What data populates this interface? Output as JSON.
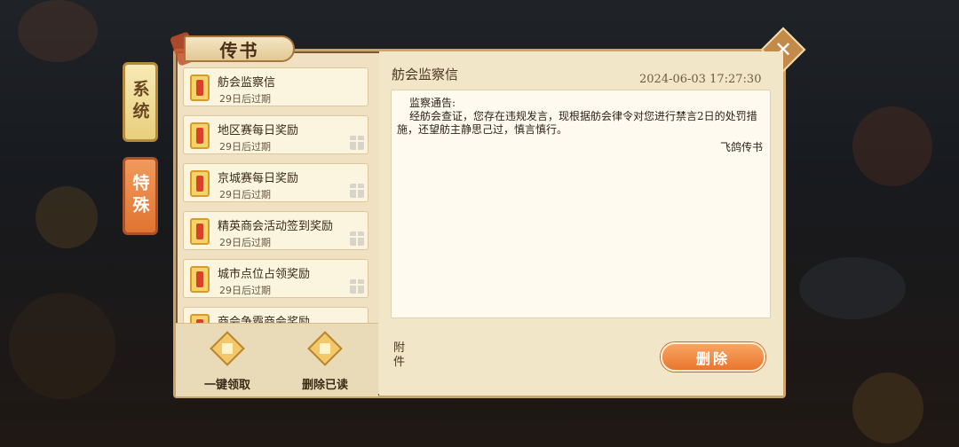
{
  "dialog": {
    "title": "传书",
    "close_icon": "close-icon"
  },
  "categories": [
    {
      "label": "系统",
      "state": "inactive"
    },
    {
      "label": "特殊",
      "state": "active"
    }
  ],
  "mails": [
    {
      "title": "舫会监察信",
      "expiry": "29日后过期",
      "has_gift": false
    },
    {
      "title": "地区赛每日奖励",
      "expiry": "29日后过期",
      "has_gift": true
    },
    {
      "title": "京城赛每日奖励",
      "expiry": "29日后过期",
      "has_gift": true
    },
    {
      "title": "精英商会活动签到奖励",
      "expiry": "29日后过期",
      "has_gift": true
    },
    {
      "title": "城市点位占领奖励",
      "expiry": "29日后过期",
      "has_gift": true
    },
    {
      "title": "商会争霸商会奖励",
      "expiry": "",
      "has_gift": false
    }
  ],
  "footer": {
    "claim_all_label": "一键领取",
    "delete_read_label": "删除已读"
  },
  "detail": {
    "title": "舫会监察信",
    "timestamp": "2024-06-03  17:27:30",
    "heading": "监察通告:",
    "body": "经舫会查证，您存在违规发言，现根据舫会律令对您进行禁言2日的处罚措施，还望舫主静思己过，慎言慎行。",
    "signature": "飞鸽传书",
    "attachment_label": "附件",
    "delete_label": "删除"
  },
  "colors": {
    "accent_orange": "#e9762f",
    "parchment": "#efe1c2",
    "border_gold": "#c9a46c"
  }
}
